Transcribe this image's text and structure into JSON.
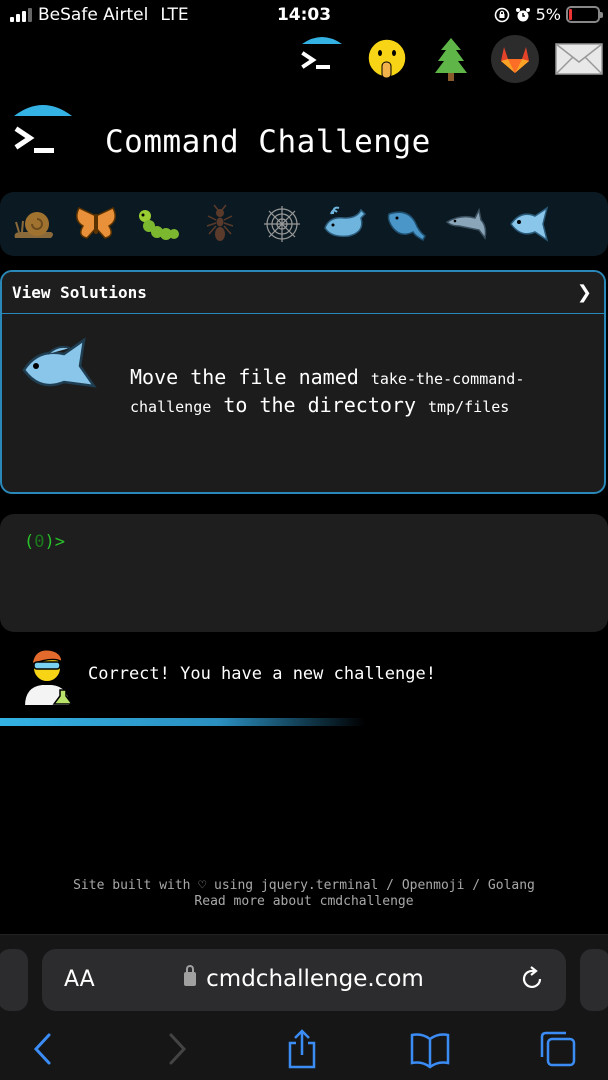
{
  "status_bar": {
    "carrier": "BeSafe Airtel",
    "network": "LTE",
    "time": "14:03",
    "battery": "5%",
    "battery_color": "#e33333"
  },
  "top_icons": [
    "terminal-umbrella-icon",
    "shushing-face-icon",
    "tree-icon",
    "gitlab-icon",
    "envelope-icon"
  ],
  "header": {
    "title": "Command Challenge"
  },
  "levels": [
    "snail-icon",
    "butterfly-icon",
    "caterpillar-icon",
    "ant-icon",
    "spider-web-icon",
    "spouting-whale-icon",
    "whale-icon",
    "dolphin-icon",
    "fish-icon"
  ],
  "challenge": {
    "header_label": "View Solutions",
    "chevron": "❯",
    "text_part1": "Move the file named ",
    "file_name": "take-the-command-challenge",
    "text_part2": " to the directory ",
    "directory": "tmp/files"
  },
  "terminal": {
    "prompt_open": "(",
    "prompt_count": "0",
    "prompt_close": ")>"
  },
  "result": {
    "message": "Correct! You have a new challenge!"
  },
  "footer": {
    "line1": "Site built with ♡ using jquery.terminal / Openmoji / Golang",
    "line2": "Read more about cmdchallenge"
  },
  "browser": {
    "text_size_label": "AA",
    "url": "cmdchallenge.com"
  },
  "colors": {
    "accent": "#2a88b8",
    "prompt": "#29c22b",
    "background": "#000000"
  }
}
